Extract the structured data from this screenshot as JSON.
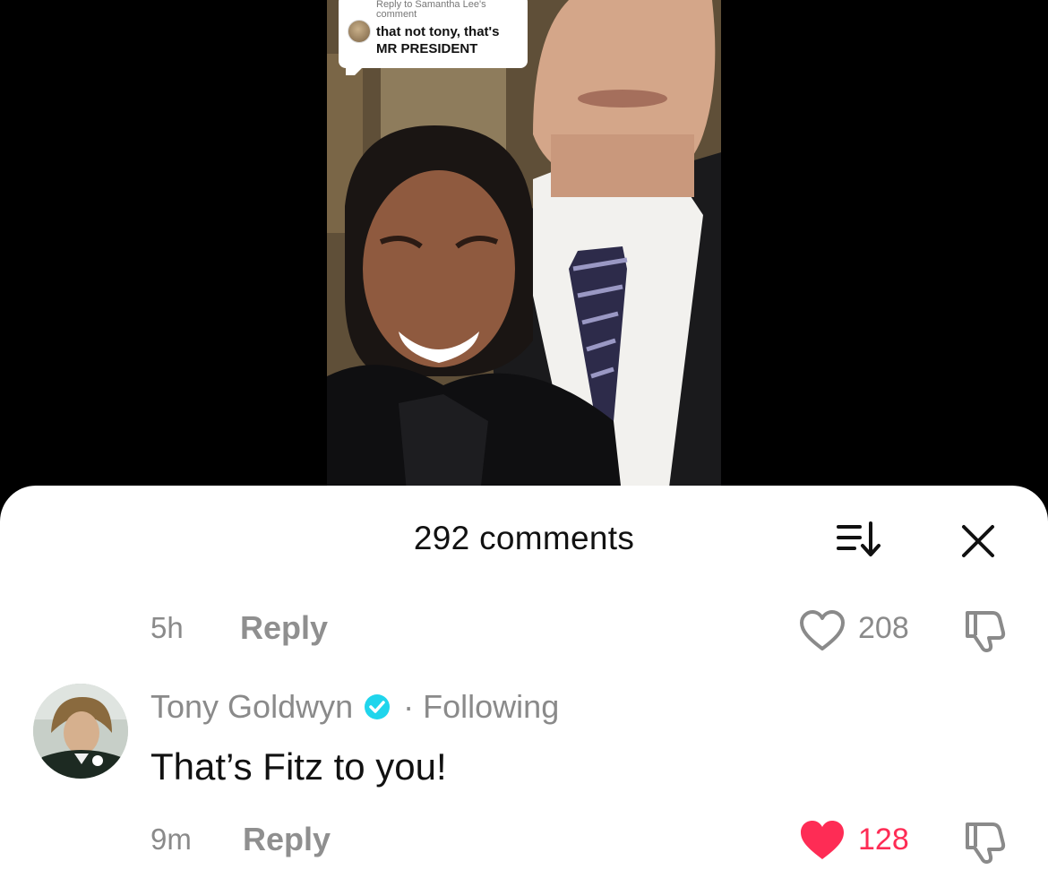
{
  "video": {
    "reply_bubble": {
      "header": "Reply to Samantha Lee's comment",
      "text": "that not tony, that's MR PRESIDENT"
    }
  },
  "sheet": {
    "title": "292 comments",
    "sort_icon": "sort-icon",
    "close_icon": "close-icon"
  },
  "comments": [
    {
      "time": "5h",
      "reply_label": "Reply",
      "like_icon": "heart-outline-icon",
      "likes": "208",
      "dislike_icon": "thumbs-down-icon"
    },
    {
      "author": "Tony Goldwyn",
      "verified": true,
      "separator": "·",
      "relation": "Following",
      "text": "That’s Fitz to you!",
      "time": "9m",
      "reply_label": "Reply",
      "like_icon": "heart-filled-icon",
      "likes": "128",
      "liked": true,
      "dislike_icon": "thumbs-down-icon"
    }
  ],
  "colors": {
    "liked": "#fe2c55",
    "muted": "#8a8a8a",
    "verified": "#20d5ec",
    "text": "#111111"
  }
}
